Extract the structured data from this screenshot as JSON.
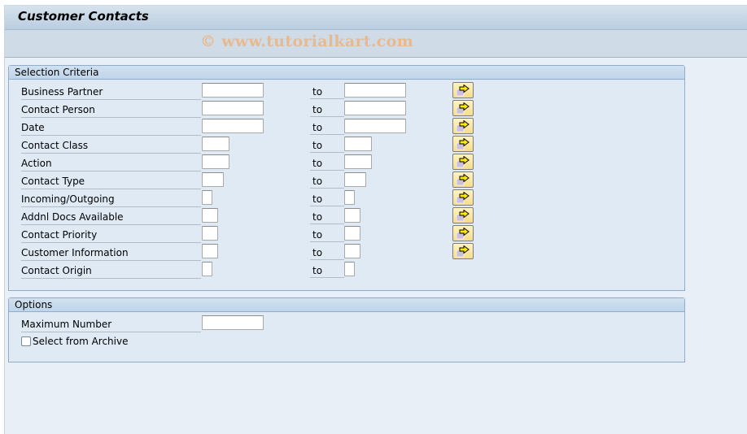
{
  "window": {
    "title": "Customer Contacts",
    "watermark": "© www.tutorialkart.com"
  },
  "selection_criteria": {
    "title": "Selection Criteria",
    "to_label": "to",
    "fields": [
      {
        "label": "Business Partner",
        "from_value": "",
        "to_value": "",
        "multiple_selection": true
      },
      {
        "label": "Contact Person",
        "from_value": "",
        "to_value": "",
        "multiple_selection": true
      },
      {
        "label": "Date",
        "from_value": "",
        "to_value": "",
        "multiple_selection": true
      },
      {
        "label": "Contact Class",
        "from_value": "",
        "to_value": "",
        "multiple_selection": true
      },
      {
        "label": "Action",
        "from_value": "",
        "to_value": "",
        "multiple_selection": true
      },
      {
        "label": "Contact Type",
        "from_value": "",
        "to_value": "",
        "multiple_selection": true
      },
      {
        "label": "Incoming/Outgoing",
        "from_value": "",
        "to_value": "",
        "multiple_selection": true
      },
      {
        "label": "Addnl Docs Available",
        "from_value": "",
        "to_value": "",
        "multiple_selection": true
      },
      {
        "label": "Contact Priority",
        "from_value": "",
        "to_value": "",
        "multiple_selection": true
      },
      {
        "label": "Customer Information",
        "from_value": "",
        "to_value": "",
        "multiple_selection": true
      },
      {
        "label": "Contact Origin",
        "from_value": "",
        "to_value": "",
        "multiple_selection": false
      }
    ]
  },
  "options": {
    "title": "Options",
    "maximum_number": {
      "label": "Maximum Number",
      "value": ""
    },
    "select_from_archive": {
      "label": "Select from Archive",
      "checked": false
    }
  },
  "icons": {
    "multiple_selection": "multiple-selection-arrow-icon"
  }
}
